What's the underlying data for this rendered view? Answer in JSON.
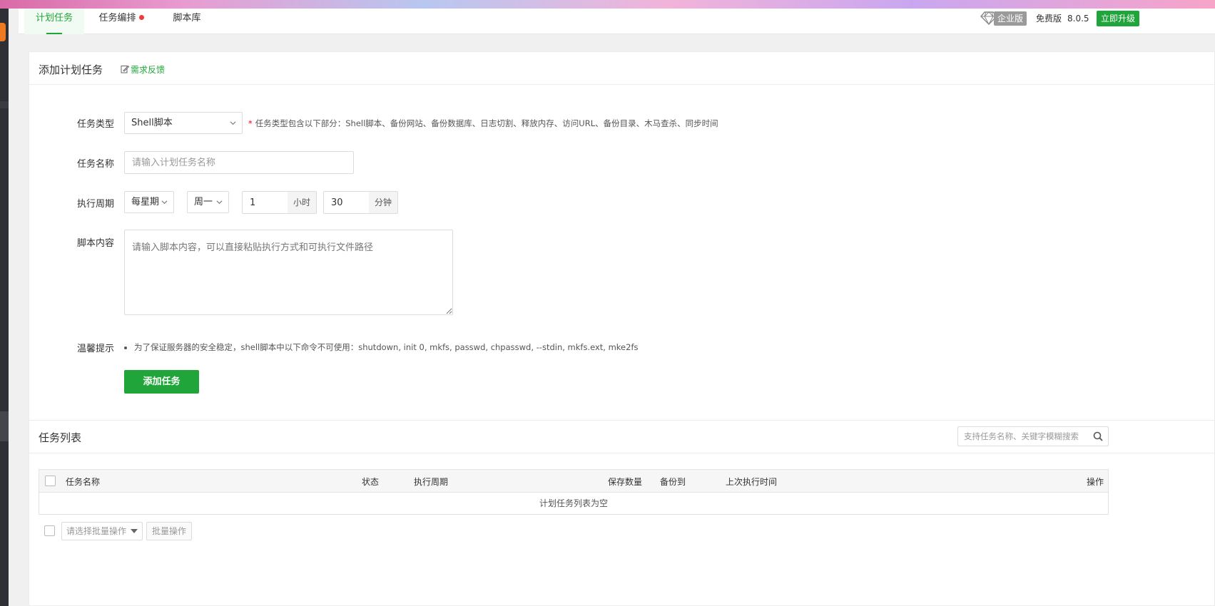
{
  "tabs": [
    {
      "label": "计划任务",
      "active": true
    },
    {
      "label": "任务编排",
      "has_dot": true
    },
    {
      "label": "脚本库"
    }
  ],
  "version_area": {
    "enterprise_label": "企业版",
    "free_label": "免费版",
    "version": "8.0.5",
    "upgrade_label": "立即升级"
  },
  "form": {
    "title": "添加计划任务",
    "feedback_label": "需求反馈",
    "task_type": {
      "label": "任务类型",
      "value": "Shell脚本",
      "hint_required": "*",
      "hint": "任务类型包含以下部分：Shell脚本、备份网站、备份数据库、日志切割、释放内存、访问URL、备份目录、木马查杀、同步时间"
    },
    "task_name": {
      "label": "任务名称",
      "placeholder": "请输入计划任务名称",
      "value": ""
    },
    "cycle": {
      "label": "执行周期",
      "period_value": "每星期",
      "weekday_value": "周一",
      "hour_value": "1",
      "hour_unit": "小时",
      "minute_value": "30",
      "minute_unit": "分钟"
    },
    "script": {
      "label": "脚本内容",
      "placeholder": "请输入脚本内容，可以直接粘贴执行方式和可执行文件路径"
    },
    "tip": {
      "label": "温馨提示",
      "text": "为了保证服务器的安全稳定，shell脚本中以下命令不可使用：shutdown, init 0, mkfs, passwd, chpasswd, --stdin, mkfs.ext, mke2fs"
    },
    "submit_label": "添加任务"
  },
  "task_list": {
    "title": "任务列表",
    "search_placeholder": "支持任务名称、关键字模糊搜索",
    "columns": [
      "任务名称",
      "状态",
      "执行周期",
      "保存数量",
      "备份到",
      "上次执行时间",
      "操作"
    ],
    "empty_text": "计划任务列表为空",
    "batch_select_placeholder": "请选择批量操作",
    "batch_button_label": "批量操作"
  },
  "colors": {
    "accent": "#20a53a",
    "dot": "#ef3a3a",
    "required": "#ef0808",
    "enterprise_badge": "#9a9a9a"
  },
  "icons": [
    "diamond-icon",
    "edit-icon",
    "chevron-down-icon",
    "search-icon",
    "caret-down-icon"
  ]
}
